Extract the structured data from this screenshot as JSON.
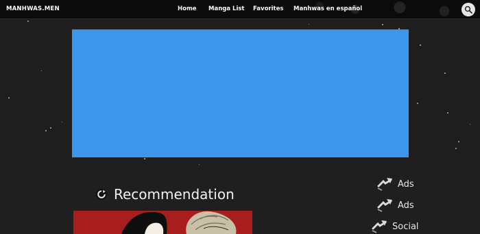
{
  "header": {
    "brand": "MANHWAS.MEN",
    "nav": [
      "Home",
      "Manga List",
      "Favorites",
      "Manhwas en español"
    ],
    "search_icon": "search-icon"
  },
  "hero": {
    "banner_color": "#3d95ec"
  },
  "recommendation": {
    "title": "Recommendation",
    "icon": "refresh-icon"
  },
  "sidebar": {
    "items": [
      {
        "label": "Ads",
        "icon": "swap-arrows-icon"
      },
      {
        "label": "Ads",
        "icon": "swap-arrows-icon"
      },
      {
        "label": "Social",
        "icon": "swap-arrows-icon"
      }
    ]
  }
}
